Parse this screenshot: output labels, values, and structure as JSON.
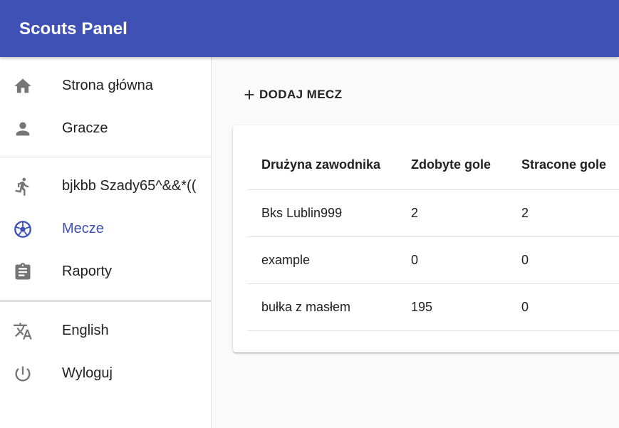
{
  "app": {
    "title": "Scouts Panel"
  },
  "sidebar": {
    "items": [
      {
        "label": "Strona główna",
        "icon": "home-icon"
      },
      {
        "label": "Gracze",
        "icon": "person-icon"
      },
      {
        "label": "bjkbb Szady65^&&*((",
        "icon": "running-person-icon"
      },
      {
        "label": "Mecze",
        "icon": "soccer-ball-icon",
        "active": true
      },
      {
        "label": "Raporty",
        "icon": "clipboard-icon"
      },
      {
        "label": "English",
        "icon": "translate-icon"
      },
      {
        "label": "Wyloguj",
        "icon": "power-icon"
      }
    ]
  },
  "main": {
    "add_button_label": "DODAJ MECZ",
    "table": {
      "headers": [
        "Drużyna zawodnika",
        "Zdobyte gole",
        "Stracone gole"
      ],
      "rows": [
        [
          "Bks Lublin999",
          "2",
          "2"
        ],
        [
          "example",
          "0",
          "0"
        ],
        [
          "bułka z masłem",
          "195",
          "0"
        ]
      ]
    }
  },
  "colors": {
    "primary": "#3f51b5",
    "icon_gray": "#757575",
    "text": "#212121"
  }
}
